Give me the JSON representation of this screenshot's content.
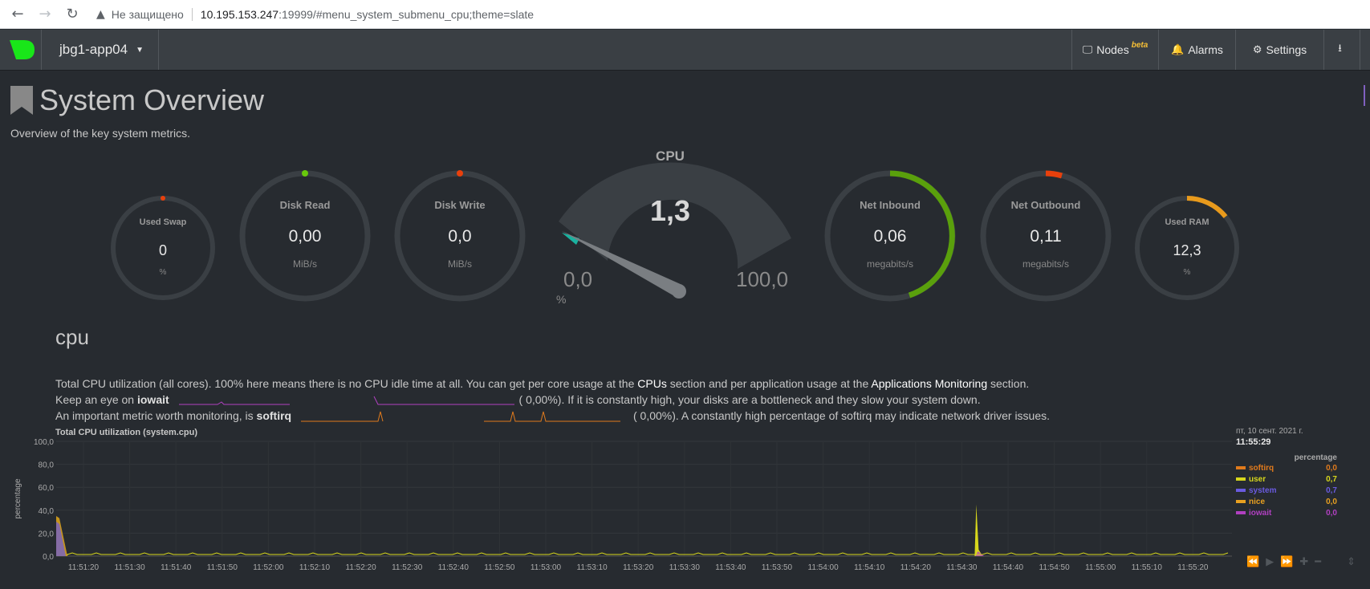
{
  "browser": {
    "insecure_label": "Не защищено",
    "url_host": "10.195.153.247",
    "url_rest": ":19999/#menu_system_submenu_cpu;theme=slate"
  },
  "topbar": {
    "host": "jbg1-app04",
    "nodes_label": "Nodes",
    "beta_label": "beta",
    "alarms_label": "Alarms",
    "settings_label": "Settings"
  },
  "page": {
    "title": "System Overview",
    "subtitle": "Overview of the key system metrics."
  },
  "gauges": {
    "swap": {
      "label": "Used Swap",
      "value": "0",
      "unit": "%"
    },
    "disk_read": {
      "label": "Disk Read",
      "value": "0,00",
      "unit": "MiB/s"
    },
    "disk_write": {
      "label": "Disk Write",
      "value": "0,0",
      "unit": "MiB/s"
    },
    "cpu": {
      "label": "CPU",
      "value": "1,3",
      "min": "0,0",
      "max": "100,0",
      "unit": "%",
      "fraction": 0.013
    },
    "net_in": {
      "label": "Net Inbound",
      "value": "0,06",
      "unit": "megabits/s",
      "fraction": 0.5
    },
    "net_out": {
      "label": "Net Outbound",
      "value": "0,11",
      "unit": "megabits/s",
      "fraction": 0.04
    },
    "ram": {
      "label": "Used RAM",
      "value": "12,3",
      "unit": "%",
      "fraction": 0.12
    }
  },
  "section": {
    "heading": "cpu",
    "line1_a": "Total CPU utilization (all cores). 100% here means there is no CPU idle time at all. You can get per core usage at the ",
    "line1_cpus": "CPUs",
    "line1_b": " section and per application usage at the ",
    "line1_apps": "Applications Monitoring",
    "line1_c": " section.",
    "line2_a": "Keep an eye on ",
    "line2_k": "iowait",
    "line2_b": "(      0,00%). If it is constantly high, your disks are a bottleneck and they slow your system down.",
    "line3_a": "An important metric worth monitoring, is ",
    "line3_k": "softirq",
    "line3_b": "(      0,00%). A constantly high percentage of softirq may indicate network driver issues."
  },
  "chart_data": {
    "type": "area",
    "title": "Total CPU utilization (system.cpu)",
    "ylabel": "percentage",
    "ylim": [
      0,
      100
    ],
    "yticks": [
      "100,0",
      "80,0",
      "60,0",
      "40,0",
      "20,0",
      "0,0"
    ],
    "xticks": [
      "11:51:20",
      "11:51:30",
      "11:51:40",
      "11:51:50",
      "11:52:00",
      "11:52:10",
      "11:52:20",
      "11:52:30",
      "11:52:40",
      "11:52:50",
      "11:53:00",
      "11:53:10",
      "11:53:20",
      "11:53:30",
      "11:53:40",
      "11:53:50",
      "11:54:00",
      "11:54:10",
      "11:54:20",
      "11:54:30",
      "11:54:40",
      "11:54:50",
      "11:55:00",
      "11:55:10",
      "11:55:20"
    ],
    "grid": true,
    "legend_position": "right",
    "series": [
      {
        "name": "softirq",
        "color": "#e07a1c",
        "value": "0,0"
      },
      {
        "name": "user",
        "color": "#d7d71c",
        "value": "0,7"
      },
      {
        "name": "system",
        "color": "#6a5be0",
        "value": "0,7"
      },
      {
        "name": "nice",
        "color": "#e8a020",
        "value": "0,0"
      },
      {
        "name": "iowait",
        "color": "#b040c0",
        "value": "0,0"
      }
    ],
    "spikes": [
      {
        "at": "11:51:15",
        "total": 35
      },
      {
        "at": "11:54:37",
        "total": 45
      }
    ]
  },
  "legend": {
    "date": "пт, 10 сент. 2021 г.",
    "time": "11:55:29",
    "header": "percentage"
  }
}
